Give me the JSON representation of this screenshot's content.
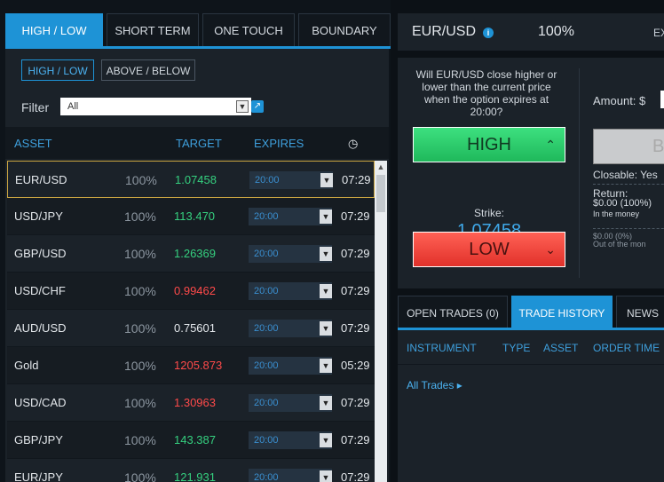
{
  "top_tabs": [
    "HIGH / LOW",
    "SHORT TERM",
    "ONE TOUCH",
    "BOUNDARY"
  ],
  "sub_tabs": [
    "HIGH / LOW",
    "ABOVE / BELOW"
  ],
  "filter": {
    "label": "Filter",
    "value": "All"
  },
  "table_headers": {
    "asset": "ASSET",
    "target": "TARGET",
    "expires": "EXPIRES"
  },
  "rows": [
    {
      "asset": "EUR/USD",
      "payout": "100%",
      "target": "1.07458",
      "target_color": "green",
      "expires": "20:00",
      "time": "07:29"
    },
    {
      "asset": "USD/JPY",
      "payout": "100%",
      "target": "113.470",
      "target_color": "green",
      "expires": "20:00",
      "time": "07:29"
    },
    {
      "asset": "GBP/USD",
      "payout": "100%",
      "target": "1.26369",
      "target_color": "green",
      "expires": "20:00",
      "time": "07:29"
    },
    {
      "asset": "USD/CHF",
      "payout": "100%",
      "target": "0.99462",
      "target_color": "red",
      "expires": "20:00",
      "time": "07:29"
    },
    {
      "asset": "AUD/USD",
      "payout": "100%",
      "target": "0.75601",
      "target_color": "white",
      "expires": "20:00",
      "time": "07:29"
    },
    {
      "asset": "Gold",
      "payout": "100%",
      "target": "1205.873",
      "target_color": "red",
      "expires": "20:00",
      "time": "05:29"
    },
    {
      "asset": "USD/CAD",
      "payout": "100%",
      "target": "1.30963",
      "target_color": "red",
      "expires": "20:00",
      "time": "07:29"
    },
    {
      "asset": "GBP/JPY",
      "payout": "100%",
      "target": "143.387",
      "target_color": "green",
      "expires": "20:00",
      "time": "07:29"
    },
    {
      "asset": "EUR/JPY",
      "payout": "100%",
      "target": "121.931",
      "target_color": "green",
      "expires": "20:00",
      "time": "07:29"
    }
  ],
  "trade": {
    "pair": "EUR/USD",
    "payout": "100%",
    "ex_label": "EX",
    "question": "Will EUR/USD close higher or lower than the current price when the option expires at 20:00?",
    "high_label": "HIGH",
    "low_label": "LOW",
    "strike_label": "Strike:",
    "strike_value": "1.07458",
    "amount_label": "Amount: $",
    "buy_label": "B",
    "closable": "Closable: Yes",
    "return_label": "Return:",
    "return_value": "$0.00 (100%)",
    "in_money": "In the money",
    "otm_value": "$0.00 (0%)",
    "otm_label": "Out of the mon"
  },
  "bottom_tabs": [
    "OPEN TRADES (0)",
    "TRADE HISTORY",
    "NEWS"
  ],
  "bottom_headers": [
    "INSTRUMENT",
    "TYPE",
    "ASSET",
    "ORDER TIME"
  ],
  "all_trades": "All Trades ▸",
  "colors": {
    "accent": "#1e93d6",
    "green": "#35d07f",
    "red": "#ff4a4a"
  }
}
